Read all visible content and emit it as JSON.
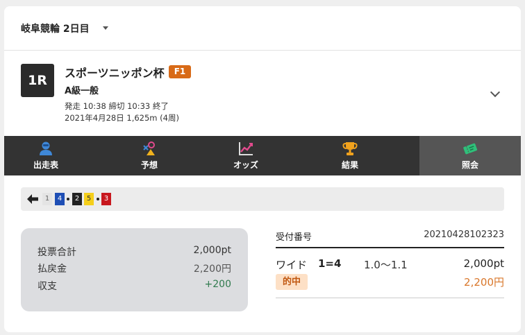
{
  "header": {
    "venue_day": "岐阜競輪 2日目"
  },
  "race": {
    "number": "1R",
    "name": "スポーツニッポン杯",
    "grade": "F1",
    "class": "A級一般",
    "times": "発走 10:38 締切 10:33 終了",
    "date_distance": "2021年4月28日 1,625m (4周)"
  },
  "tabs": [
    {
      "label": "出走表",
      "icon": "rider-icon"
    },
    {
      "label": "予想",
      "icon": "prediction-icon"
    },
    {
      "label": "オッズ",
      "icon": "odds-chart-icon"
    },
    {
      "label": "結果",
      "icon": "trophy-icon"
    },
    {
      "label": "照会",
      "icon": "ticket-icon"
    }
  ],
  "bet_selection": {
    "numbers": [
      {
        "n": "1",
        "bg": "#e4e4e4",
        "fg": "#666"
      },
      {
        "n": "4",
        "bg": "#1f4fb5",
        "fg": "#ffffff"
      },
      {
        "n": "2",
        "bg": "#222222",
        "fg": "#ffffff"
      },
      {
        "n": "5",
        "bg": "#f5cf1b",
        "fg": "#333333"
      },
      {
        "n": "3",
        "bg": "#c8181f",
        "fg": "#ffffff"
      }
    ]
  },
  "summary": {
    "total_label": "投票合計",
    "total_value": "2,000pt",
    "payout_label": "払戻金",
    "payout_value": "2,200円",
    "balance_label": "収支",
    "balance_value": "+200"
  },
  "receipt": {
    "number_label": "受付番号",
    "number_value": "20210428102323",
    "bet_type": "ワイド",
    "combination": "1=4",
    "odds": "1.0〜1.1",
    "amount": "2,000pt",
    "hit_label": "的中",
    "payout": "2,200円"
  },
  "colors": {
    "tab_bar": "#333333",
    "tab_active": "#555555",
    "grade_badge": "#d86a17",
    "profit": "#2f7a4d",
    "payout": "#d9772b"
  }
}
